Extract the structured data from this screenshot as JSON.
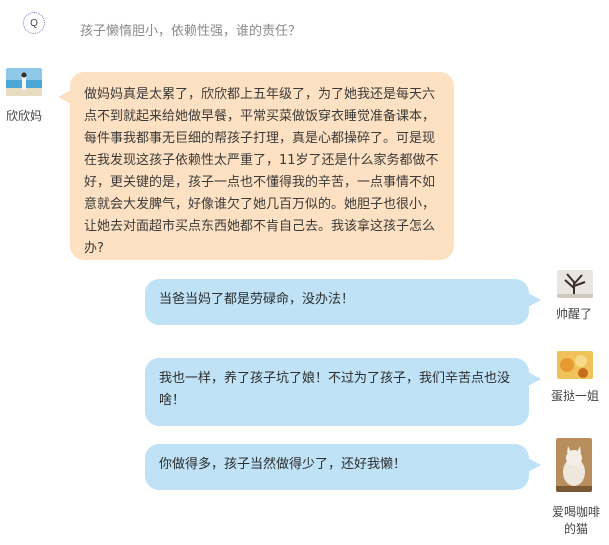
{
  "question": {
    "badge": "Q",
    "text": "孩子懒惰胆小，依赖性强，谁的责任？"
  },
  "messages": [
    {
      "user": "欣欣妈",
      "text": "做妈妈真是太累了，欣欣都上五年级了，为了她我还是每天六点不到就起来给她做早餐，平常买菜做饭穿衣睡觉准备课本，每件事我都事无巨细的帮孩子打理，真是心都操碎了。可是现在我发现这孩子依赖性太严重了，11岁了还是什么家务都做不好，更关键的是，孩子一点也不懂得我的辛苦，一点事情不如意就会大发脾气，好像谁欠了她几百万似的。她胆子也很小，让她去对面超市买点东西她都不肯自己去。我该拿这孩子怎么办?"
    },
    {
      "user": "帅醒了",
      "text": "当爸当妈了都是劳碌命，没办法！"
    },
    {
      "user": "蛋挞一姐",
      "text": "我也一样，养了孩子坑了娘！不过为了孩子，我们辛苦点也没啥！"
    },
    {
      "user": "爱喝咖啡的猫",
      "text": "你做得多，孩子当然做得少了，还好我懒！"
    }
  ]
}
